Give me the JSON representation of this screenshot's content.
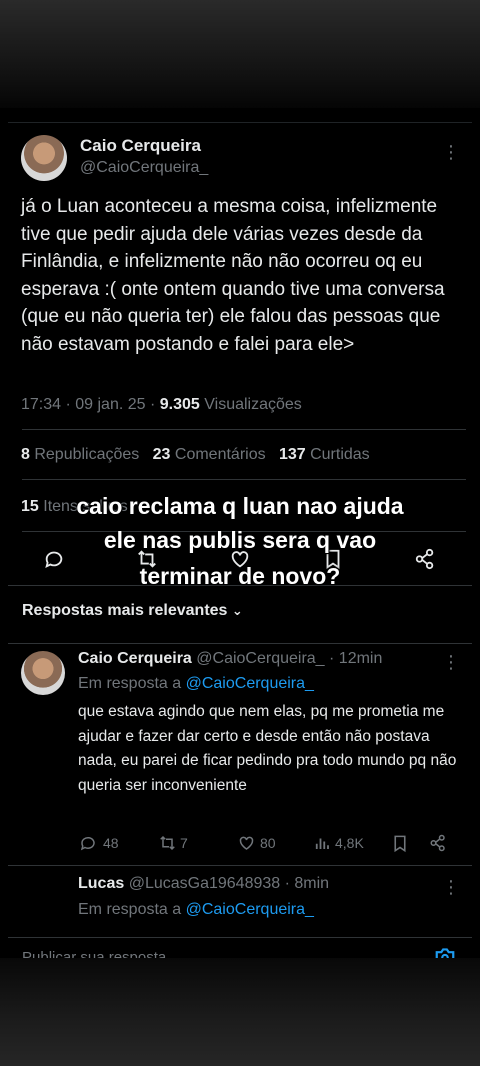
{
  "tweet": {
    "author_name": "Caio Cerqueira",
    "author_handle": "@CaioCerqueira_",
    "text": "já o Luan aconteceu a mesma coisa, infelizmente tive que pedir ajuda dele várias vezes desde da Finlândia, e infelizmente não não ocorreu oq eu esperava :( onte ontem quando tive uma conversa (que eu não queria ter) ele falou das pessoas que não estavam postando e falei para ele>",
    "time": "17:34 · 09 jan. 25 · ",
    "views_count": "9.305",
    "views_label": " Visualizações",
    "reposts_count": "8",
    "reposts_label": " Republicações",
    "comments_count": "23",
    "comments_label": " Comentários",
    "likes_count": "137",
    "likes_label": " Curtidas",
    "saves_count": "15",
    "saves_label": " Itens salvos"
  },
  "overlay": {
    "line1": "caio reclama q luan nao ajuda",
    "line2": "ele nas publis sera q vao",
    "line3": "terminar de novo?"
  },
  "replies_header": "Respostas mais relevantes",
  "replies": [
    {
      "name": "Caio Cerqueira",
      "handle": "@CaioCerqueira_ · 12min",
      "reply_to_label": "Em resposta a ",
      "reply_to_handle": "@CaioCerqueira_",
      "text": "que estava agindo que nem elas, pq me prometia me ajudar e fazer dar certo e desde então não postava nada, eu parei de ficar pedindo pra todo mundo pq não queria ser inconveniente",
      "comments": "48",
      "reposts": "7",
      "likes": "80",
      "views": "4,8K"
    },
    {
      "name": "Lucas",
      "handle": "@LucasGa19648938 · 8min",
      "reply_to_label": "Em resposta a ",
      "reply_to_handle": "@CaioCerqueira_"
    }
  ],
  "compose_placeholder": "Publicar sua resposta",
  "colors": {
    "background": "#000000",
    "text": "#e7e9ea",
    "muted": "#71767b",
    "link": "#1d9bf0",
    "divider": "#2f3336"
  }
}
